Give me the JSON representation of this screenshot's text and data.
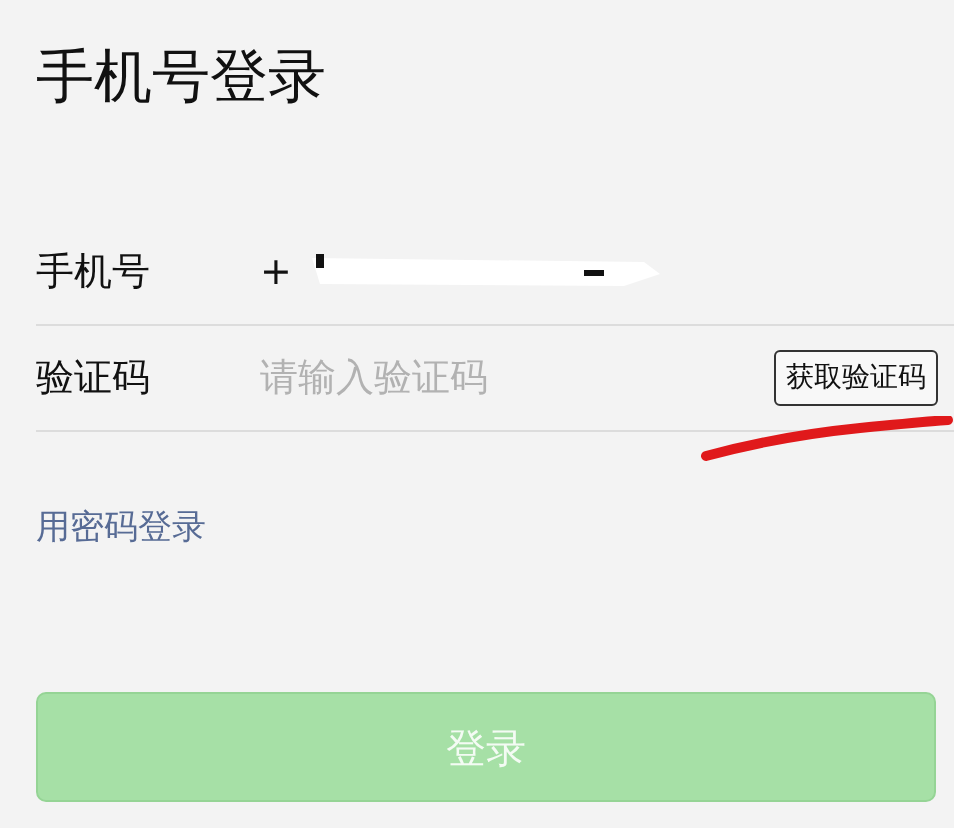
{
  "title": "手机号登录",
  "fields": [
    {
      "label": "手机号",
      "kind": "phone",
      "value": "+"
    },
    {
      "label": "验证码",
      "kind": "code",
      "placeholder": "请输入验证码",
      "button": "获取验证码"
    }
  ],
  "password_login_link": "用密码登录",
  "login_button": {
    "label": "登录",
    "disabled": true
  }
}
